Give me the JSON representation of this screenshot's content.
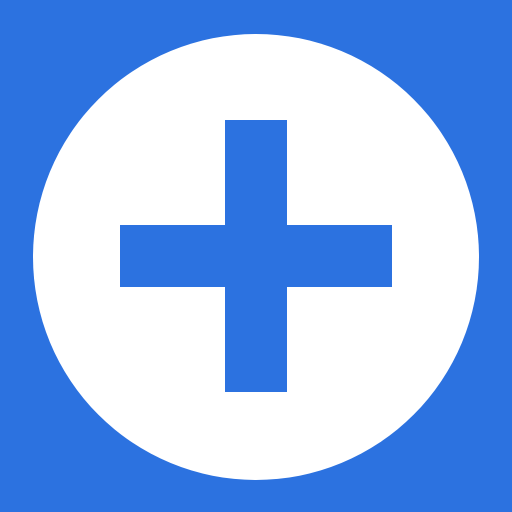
{
  "icon": {
    "name": "add-circle-icon",
    "background_color": "#2c72e0",
    "circle_color": "#ffffff",
    "plus_color": "#2c72e0"
  }
}
